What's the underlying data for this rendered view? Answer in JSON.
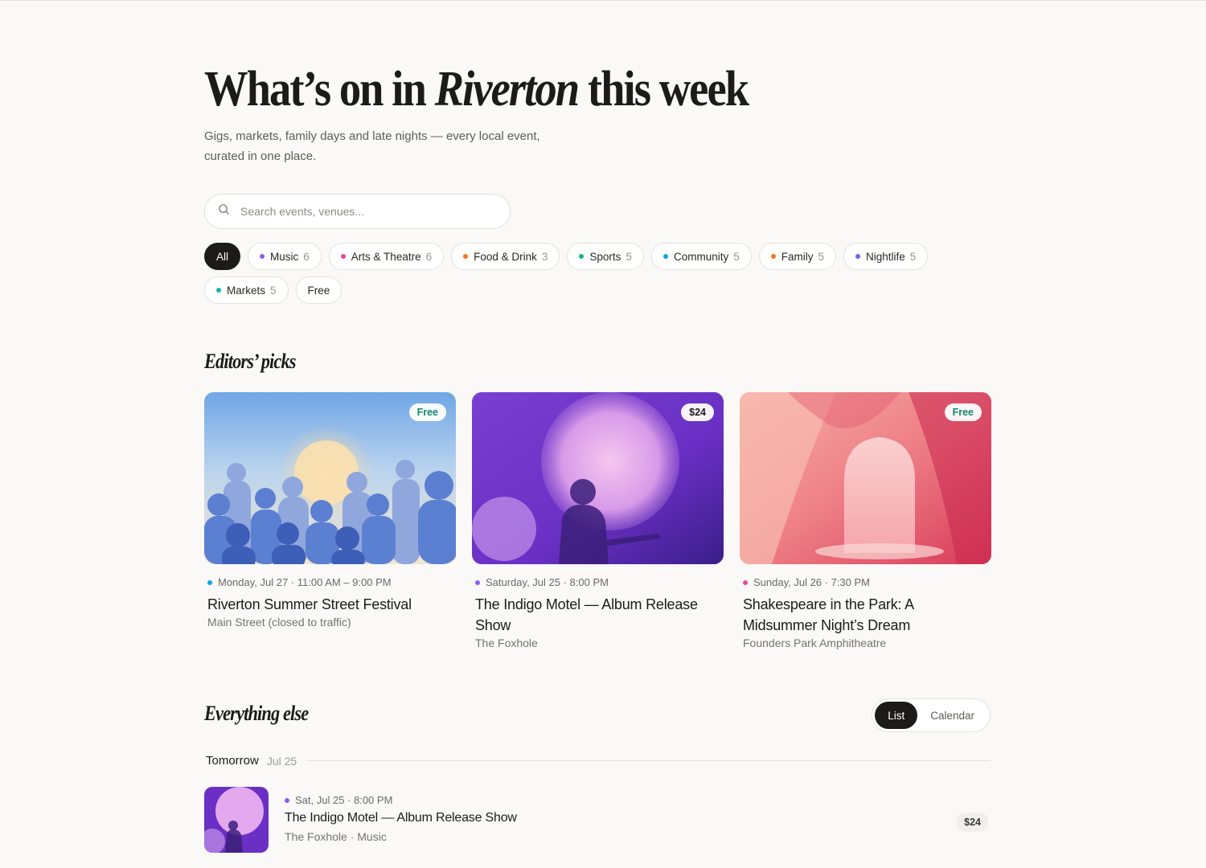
{
  "hero": {
    "title_pre": "What’s on in ",
    "title_em": "Riverton",
    "title_post": " this week",
    "subtitle": "Gigs, markets, family days and late nights — every local event, curated in one place."
  },
  "search": {
    "placeholder": "Search events, venues..."
  },
  "filters": [
    {
      "label": "All",
      "active": true
    },
    {
      "label": "Music",
      "count": "6",
      "color": "#8b5cf6"
    },
    {
      "label": "Arts & Theatre",
      "count": "6",
      "color": "#ec4899"
    },
    {
      "label": "Food & Drink",
      "count": "3",
      "color": "#f97316"
    },
    {
      "label": "Sports",
      "count": "5",
      "color": "#10b981"
    },
    {
      "label": "Community",
      "count": "5",
      "color": "#0ea5e9"
    },
    {
      "label": "Family",
      "count": "5",
      "color": "#f97316"
    },
    {
      "label": "Nightlife",
      "count": "5",
      "color": "#6366f1"
    },
    {
      "label": "Markets",
      "count": "5",
      "color": "#14b8a6"
    },
    {
      "label": "Free"
    }
  ],
  "editors_picks": {
    "title": "Editors’ picks",
    "cards": [
      {
        "price": "Free",
        "date": "Monday, Jul 27 · 11:00 AM – 9:00 PM",
        "dot_color": "#0ea5e9",
        "title": "Riverton Summer Street Festival",
        "venue": "Main Street (closed to traffic)",
        "image": "crowd-festival-illustration"
      },
      {
        "price": "$24",
        "date": "Saturday, Jul 25 · 8:00 PM",
        "dot_color": "#8b5cf6",
        "title": "The Indigo Motel — Album Release Show",
        "venue": "The Foxhole",
        "image": "guitarist-silhouette-illustration"
      },
      {
        "price": "Free",
        "date": "Sunday, Jul 26 · 7:30 PM",
        "dot_color": "#ec4899",
        "title": "Shakespeare in the Park: A Midsummer Night’s Dream",
        "venue": "Founders Park Amphitheatre",
        "image": "theatre-curtain-illustration"
      }
    ]
  },
  "everything_else": {
    "title": "Everything else",
    "view_toggle": {
      "list": "List",
      "calendar": "Calendar",
      "active": "List"
    },
    "day": {
      "label": "Tomorrow",
      "date": "Jul 25"
    },
    "events": [
      {
        "date": "Sat, Jul 25 · 8:00 PM",
        "dot_color": "#8b5cf6",
        "title": "The Indigo Motel — Album Release Show",
        "sub": "The Foxhole · Music",
        "price": "$24"
      }
    ]
  }
}
